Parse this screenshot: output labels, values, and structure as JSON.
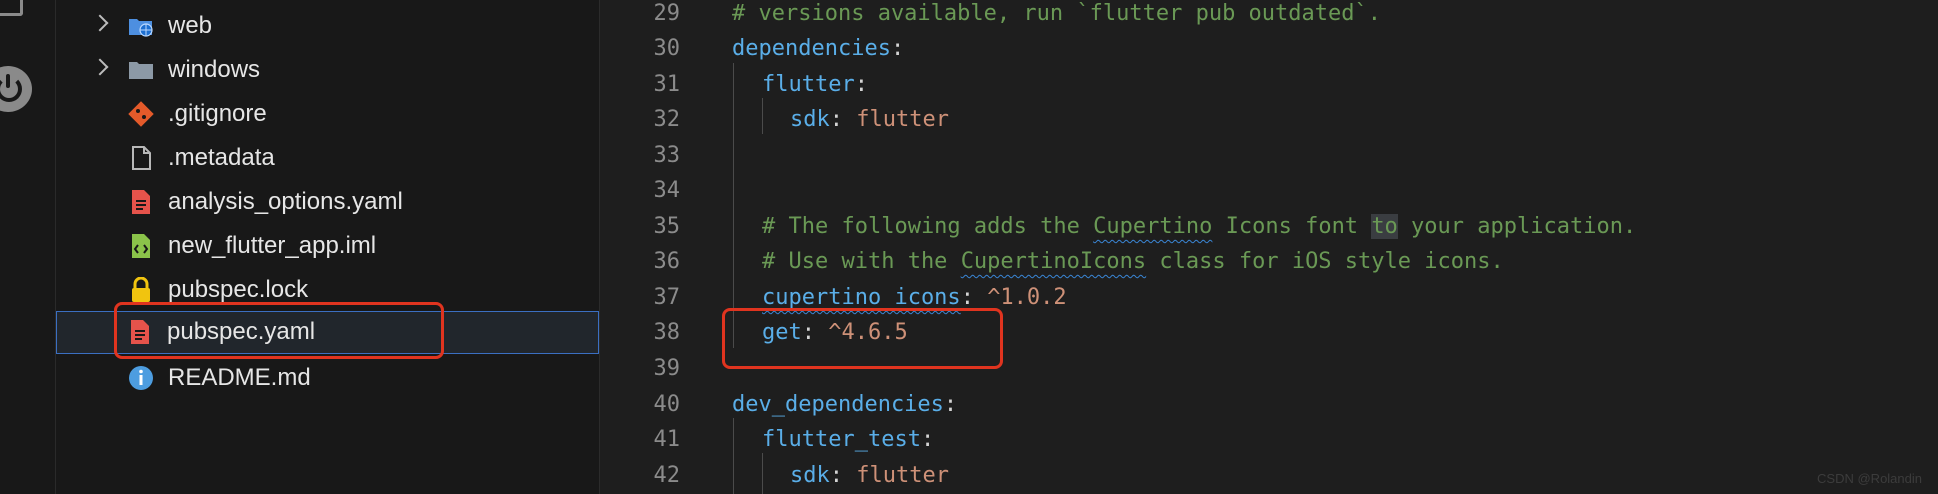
{
  "explorer": {
    "items": [
      {
        "label": "web",
        "icon": "folder-web-icon",
        "folder": true
      },
      {
        "label": "windows",
        "icon": "folder-icon",
        "folder": true
      },
      {
        "label": ".gitignore",
        "icon": "git-icon"
      },
      {
        "label": ".metadata",
        "icon": "file-icon"
      },
      {
        "label": "analysis_options.yaml",
        "icon": "yaml-file-icon"
      },
      {
        "label": "new_flutter_app.iml",
        "icon": "iml-file-icon"
      },
      {
        "label": "pubspec.lock",
        "icon": "lock-icon"
      },
      {
        "label": "pubspec.yaml",
        "icon": "yaml-file-icon",
        "selected": true
      },
      {
        "label": "README.md",
        "icon": "info-icon"
      }
    ]
  },
  "editor": {
    "line_numbers": [
      "29",
      "30",
      "31",
      "32",
      "33",
      "34",
      "35",
      "36",
      "37",
      "38",
      "39",
      "40",
      "41",
      "42"
    ],
    "lines": {
      "l29": "# versions available, run `flutter pub outdated`.",
      "l30_key": "dependencies",
      "l31_key": "flutter",
      "l32_key": "sdk",
      "l32_val": "flutter",
      "l35_a": "# The following adds the ",
      "l35_b": "Cupertino",
      "l35_c": " Icons font ",
      "l35_d": "to",
      "l35_e": " your application.",
      "l36_a": "# Use with the ",
      "l36_b": "CupertinoIcons",
      "l36_c": " class for iOS style icons.",
      "l37_key": "cupertino_icons",
      "l37_val": "^1.0.2",
      "l38_key": "get",
      "l38_val": "^4.6.5",
      "l40_key": "dev_dependencies",
      "l41_key": "flutter_test",
      "l42_key": "sdk",
      "l42_val": "flutter",
      "colon": ":"
    }
  },
  "watermark": "CSDN @Rolandin",
  "colors": {
    "highlight": "#e0341f",
    "selection_border": "#3b6fc2",
    "key": "#5aaee8",
    "value": "#ce9178",
    "comment": "#6a9955"
  }
}
